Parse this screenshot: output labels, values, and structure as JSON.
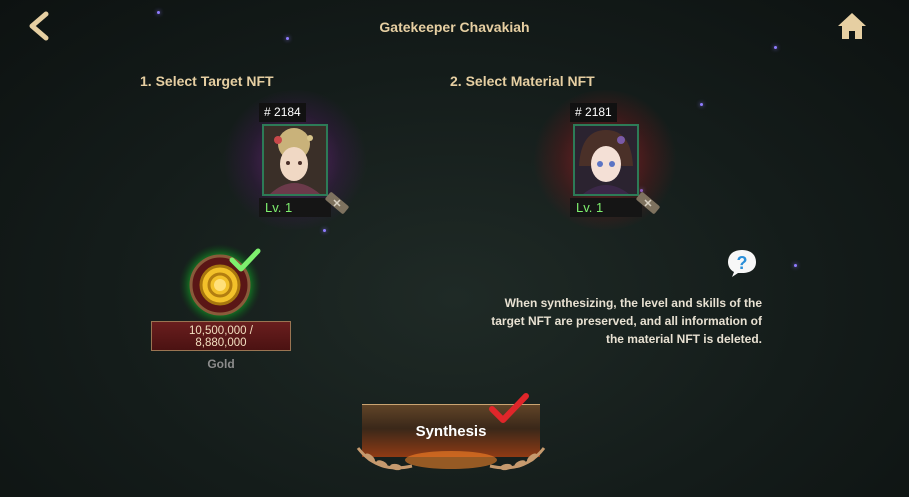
{
  "header": {
    "title": "Gatekeeper Chavakiah",
    "back_icon": "chevron-left-icon",
    "home_icon": "home-icon"
  },
  "target": {
    "section_label": "1. Select Target NFT",
    "card": {
      "id_prefix": "#",
      "id": "2184",
      "level": "Lv. 1"
    }
  },
  "material": {
    "section_label": "2. Select Material NFT",
    "card": {
      "id_prefix": "#",
      "id": "2181",
      "level": "Lv. 1"
    }
  },
  "gold": {
    "amount_line1": "10,500,000 /",
    "amount_line2": "8,880,000",
    "label": "Gold",
    "status_icon": "checkmark-icon"
  },
  "info": {
    "line1": "When synthesizing, the level and skills of the",
    "line2": "target NFT are preserved, and all information of",
    "line3": "the material NFT is deleted.",
    "help_icon": "question-mark-icon"
  },
  "synthesis": {
    "label": "Synthesis",
    "ready_icon": "checkmark-icon"
  },
  "colors": {
    "title": "#e6cfa2",
    "level_text": "#7ef06e",
    "check_green": "#7ef06e",
    "check_red": "#e0262a",
    "gold_glow": "#1fd13a",
    "target_glow": "#9628aa",
    "material_glow": "#c81e28"
  }
}
